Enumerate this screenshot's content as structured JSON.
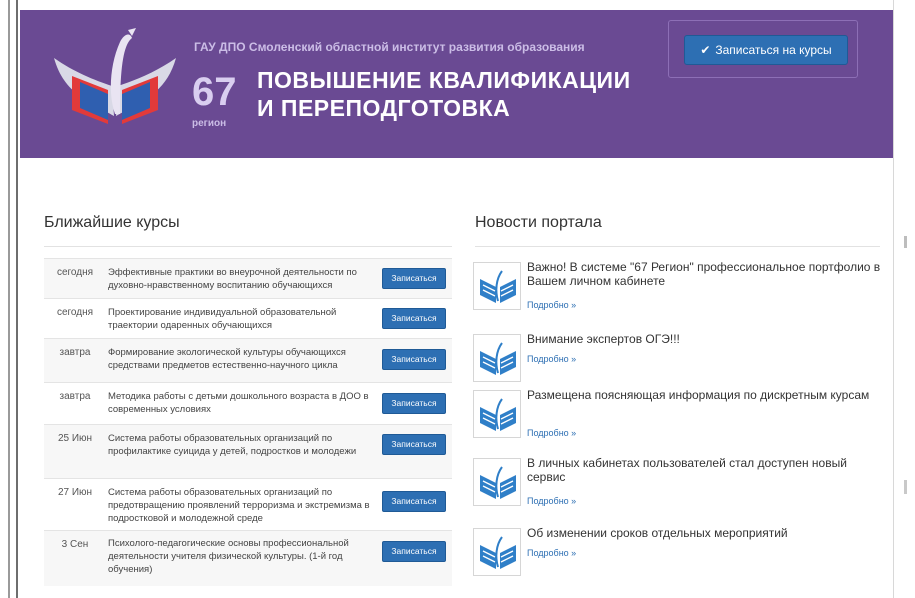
{
  "header": {
    "institute": "ГАУ ДПО Смоленский областной институт развития образования",
    "region_number": "67",
    "region_label": "регион",
    "title_line1": "ПОВЫШЕНИЕ КВАЛИФИКАЦИИ",
    "title_line2": "И ПЕРЕПОДГОТОВКА",
    "enroll_button": "Записаться на курсы",
    "check_icon": "✔",
    "colors": {
      "header_bg": "#6a4a93",
      "button_bg": "#2d6fb3"
    }
  },
  "courses": {
    "title": "Ближайшие курсы",
    "button_label": "Записаться",
    "items": [
      {
        "date": "сегодня",
        "text": "Эффективные практики во внеурочной деятельности по духовно-нравственному воспитанию обучающихся"
      },
      {
        "date": "сегодня",
        "text": "Проектирование индивидуальной образовательной траектории одаренных обучающихся"
      },
      {
        "date": "завтра",
        "text": "Формирование экологической культуры обучающихся средствами предметов естественно-научного цикла"
      },
      {
        "date": "завтра",
        "text": "Методика работы с детьми дошкольного возраста в ДОО в современных условиях"
      },
      {
        "date": "25 Июн",
        "text": "Система работы образовательных организаций по профилактике суицида у детей, подростков и молодежи"
      },
      {
        "date": "27 Июн",
        "text": "Система работы образовательных организаций по предотвращению проявлений терроризма и экстремизма в подростковой и молодежной среде"
      },
      {
        "date": "3 Сен",
        "text": "Психолого-педагогические основы профессиональной деятельности учителя физической культуры. (1-й год обучения)"
      }
    ]
  },
  "news": {
    "title": "Новости портала",
    "more_label": "Подробно »",
    "items": [
      {
        "title": "Важно! В системе \"67 Регион\" профессиональное портфолио в Вашем личном кабинете"
      },
      {
        "title": "Внимание экспертов ОГЭ!!!"
      },
      {
        "title": "Размещена поясняющая информация по дискретным курсам"
      },
      {
        "title": "В личных кабинетах пользователей стал доступен новый сервис"
      },
      {
        "title": "Об изменении сроков отдельных мероприятий"
      }
    ]
  }
}
